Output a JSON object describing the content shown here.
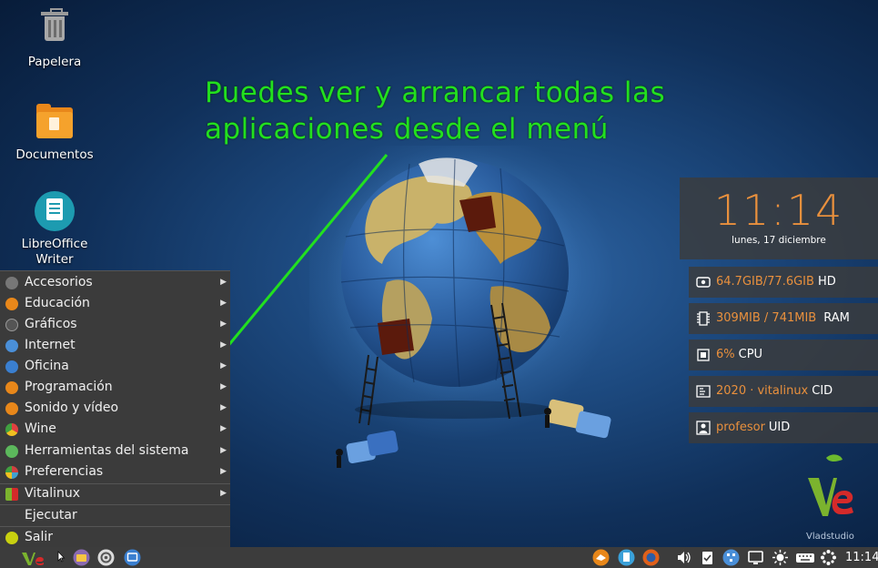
{
  "desktop": {
    "icons": [
      {
        "label": "Papelera"
      },
      {
        "label": "Documentos"
      },
      {
        "label": "LibreOffice Writer"
      }
    ]
  },
  "headline": {
    "line1": "Puedes ver y arrancar todas las",
    "line2": "aplicaciones desde el menú",
    "color": "#22e01f"
  },
  "conky": {
    "time": "11:14",
    "date": "lunes, 17 diciembre",
    "stats": [
      {
        "value": "64.7GIB/77.6GIB",
        "label": "HD",
        "icon": "hard-disk-icon"
      },
      {
        "value": "309MIB / 741MIB",
        "label": "RAM",
        "icon": "memory-chip-icon"
      },
      {
        "value": "6%",
        "label": "CPU",
        "icon": "cpu-icon"
      },
      {
        "value": "2020 · vitalinux",
        "label": "CID",
        "icon": "id-card-icon"
      },
      {
        "value": "profesor",
        "label": "UID",
        "icon": "user-icon"
      }
    ],
    "accent": "#e9903d"
  },
  "menu": {
    "items": [
      {
        "label": "Accesorios",
        "submenu": true,
        "icon": "accessories-icon",
        "color": "#777777"
      },
      {
        "label": "Educación",
        "submenu": true,
        "icon": "education-icon",
        "color": "#e8871a"
      },
      {
        "label": "Gráficos",
        "submenu": true,
        "icon": "graphics-icon",
        "color": "#555555"
      },
      {
        "label": "Internet",
        "submenu": true,
        "icon": "internet-icon",
        "color": "#4a8fd8"
      },
      {
        "label": "Oficina",
        "submenu": true,
        "icon": "office-icon",
        "color": "#3a7fd0"
      },
      {
        "label": "Programación",
        "submenu": true,
        "icon": "programming-icon",
        "color": "#e8871a"
      },
      {
        "label": "Sonido y vídeo",
        "submenu": true,
        "icon": "multimedia-icon",
        "color": "#e8871a"
      },
      {
        "label": "Wine",
        "submenu": true,
        "icon": "wine-icon",
        "color": "#e04040"
      },
      {
        "label": "Herramientas del sistema",
        "submenu": true,
        "icon": "system-tools-icon",
        "color": "#5cb85c"
      },
      {
        "label": "Preferencias",
        "submenu": true,
        "icon": "preferences-icon",
        "color": "#d04040"
      },
      {
        "label": "Vitalinux",
        "submenu": true,
        "icon": "vitalinux-icon",
        "color": "#7bb32e"
      },
      {
        "label": "Ejecutar",
        "submenu": false,
        "icon": "",
        "color": ""
      },
      {
        "label": "Salir",
        "submenu": false,
        "icon": "exit-icon",
        "color": "#c8d010"
      }
    ]
  },
  "taskbar": {
    "clock": "11:14"
  },
  "watermark": "Vladstudio"
}
